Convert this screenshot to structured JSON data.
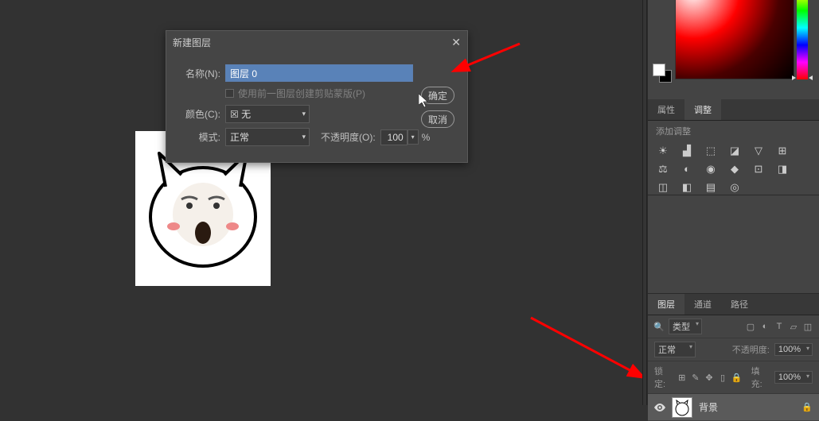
{
  "dialog": {
    "title": "新建图层",
    "name_label": "名称(N):",
    "name_value": "图层 0",
    "clip_mask_label": "使用前一图层创建剪贴蒙版(P)",
    "color_label": "颜色(C):",
    "color_value": "☒ 无",
    "mode_label": "模式:",
    "mode_value": "正常",
    "opacity_label": "不透明度(O):",
    "opacity_value": "100",
    "opacity_suffix": "%",
    "ok": "确定",
    "cancel": "取消"
  },
  "props_tabs": {
    "properties": "属性",
    "adjustments": "调整"
  },
  "adjustments": {
    "add_label": "添加调整"
  },
  "layers_panel": {
    "tabs": {
      "layers": "图层",
      "channels": "通道",
      "paths": "路径"
    },
    "kind_label": "类型",
    "blend_mode": "正常",
    "opacity_label": "不透明度:",
    "opacity": "100%",
    "lock_label": "锁定:",
    "fill_label": "填充:",
    "fill": "100%",
    "items": [
      {
        "name": "背景",
        "visible": true,
        "locked": true
      }
    ]
  }
}
